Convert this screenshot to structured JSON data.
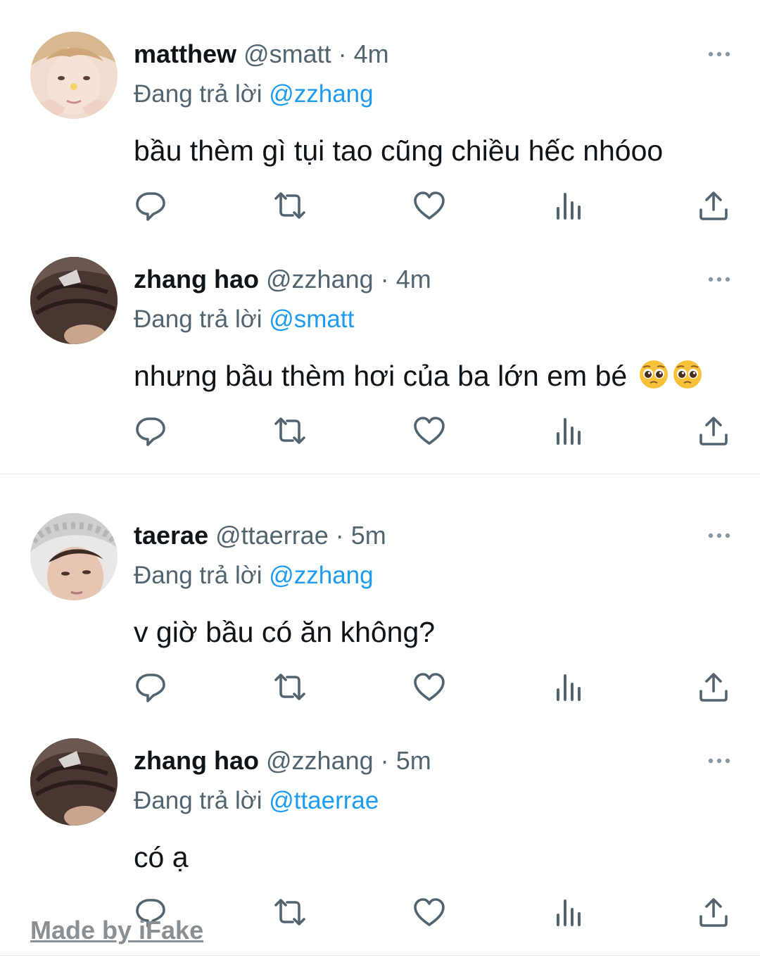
{
  "tweets": [
    {
      "name": "matthew",
      "handle": "@smatt",
      "separator": "·",
      "time": "4m",
      "reply_prefix": "Đang trả lời",
      "reply_to": "@zzhang",
      "text": "bầu thèm gì tụi tao cũng chiều hếc nhóoo",
      "avatar": "avatar-matthew"
    },
    {
      "name": "zhang hao",
      "handle": "@zzhang",
      "separator": "·",
      "time": "4m",
      "reply_prefix": "Đang trả lời",
      "reply_to": "@smatt",
      "text": "nhưng bầu thèm hơi của ba lớn em bé",
      "emoji": [
        "pleading-face-emoji",
        "pleading-face-emoji"
      ],
      "avatar": "avatar-zhang-hao"
    },
    {
      "name": "taerae",
      "handle": "@ttaerrae",
      "separator": "·",
      "time": "5m",
      "reply_prefix": "Đang trả lời",
      "reply_to": "@zzhang",
      "text": "v giờ bầu có ăn không?",
      "avatar": "avatar-taerae"
    },
    {
      "name": "zhang hao",
      "handle": "@zzhang",
      "separator": "·",
      "time": "5m",
      "reply_prefix": "Đang trả lời",
      "reply_to": "@ttaerrae",
      "text": "có ạ",
      "avatar": "avatar-zhang-hao"
    }
  ],
  "action_icons": [
    "reply-icon",
    "retweet-icon",
    "like-icon",
    "views-icon",
    "share-icon"
  ],
  "watermark": "Made by iFake",
  "colors": {
    "text": "#0f1419",
    "secondary": "#536471",
    "mention": "#1d9bf0",
    "icon": "#536471",
    "divider": "#e6e9eb"
  }
}
